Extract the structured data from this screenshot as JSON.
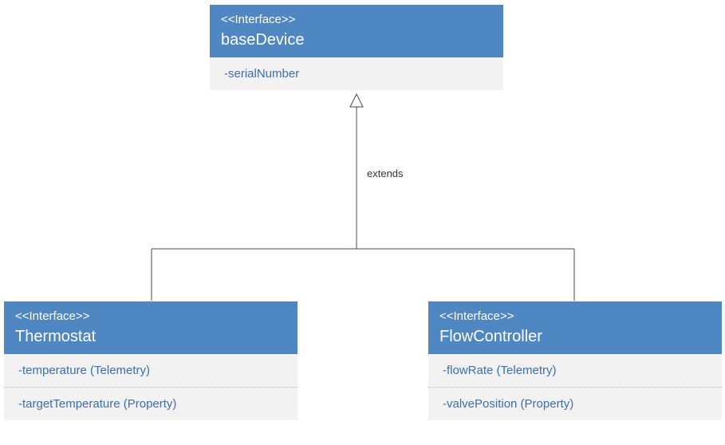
{
  "diagram": {
    "relation_label": "extends",
    "nodes": {
      "base": {
        "stereotype": "<<Interface>>",
        "name": "baseDevice",
        "attrs": [
          "-serialNumber"
        ]
      },
      "thermostat": {
        "stereotype": "<<Interface>>",
        "name": "Thermostat",
        "attrs": [
          "-temperature (Telemetry)",
          "-targetTemperature (Property)"
        ]
      },
      "flow": {
        "stereotype": "<<Interface>>",
        "name": "FlowController",
        "attrs": [
          "-flowRate (Telemetry)",
          "-valvePosition (Property)"
        ]
      }
    }
  }
}
